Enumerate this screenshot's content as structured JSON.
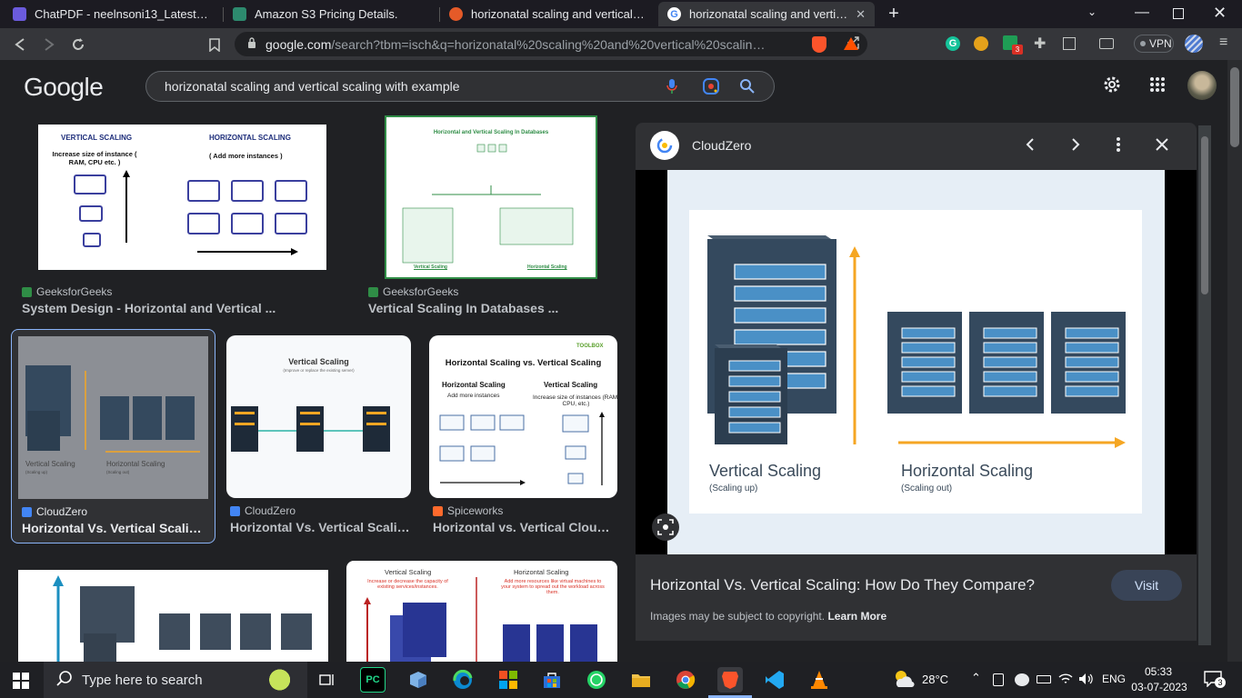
{
  "tabs": [
    {
      "title": "ChatPDF - neelnsoni13_Latest_Resume",
      "color": "#6b5bdc"
    },
    {
      "title": "Amazon S3 Pricing Details.",
      "color": "#2d8a6e"
    },
    {
      "title": "horizonatal scaling and vertical scaling",
      "color": "#e55a28"
    },
    {
      "title": "horizonatal scaling and vertical scaling",
      "color": "#4285f4"
    }
  ],
  "newtab": "+",
  "address": {
    "host": "google.com",
    "path": "/search?tbm=isch&q=horizonatal%20scaling%20and%20vertical%20scaling..."
  },
  "toolbar": {
    "vpn": "VPN",
    "ext_badge": "3"
  },
  "google": {
    "logo": "Google",
    "query": "horizonatal scaling and vertical scaling with example"
  },
  "results": [
    {
      "source": "GeeksforGeeks",
      "title": "System Design - Horizontal and Vertical ...",
      "src_color": "#2f8d46",
      "thumb": {
        "left_title": "VERTICAL SCALING",
        "left_sub": "Increase size of instance ( RAM, CPU etc. )",
        "right_title": "HORIZONTAL SCALING",
        "right_sub": "( Add more instances )"
      }
    },
    {
      "source": "GeeksforGeeks",
      "title": "Vertical Scaling In Databases ...",
      "src_color": "#2f8d46",
      "thumb": {
        "heading": "Horizontal and Vertical Scaling In Databases",
        "foot_left": "Vertical Scaling",
        "foot_right": "Horizontal Scaling"
      }
    },
    {
      "source": "CloudZero",
      "title": "Horizontal Vs. Vertical Scalin...",
      "src_color": "#4285f4",
      "thumb": {
        "left": "Vertical Scaling",
        "left_sub": "(Scaling up)",
        "right": "Horizontal Scaling",
        "right_sub": "(Scaling out)"
      }
    },
    {
      "source": "CloudZero",
      "title": "Horizontal Vs. Vertical Scalin...",
      "src_color": "#4285f4",
      "thumb": {
        "heading": "Vertical Scaling",
        "sub": "(Improve or replace the existing server)"
      }
    },
    {
      "source": "Spiceworks",
      "title": "Horizontal vs. Vertical Cloud ...",
      "src_color": "#ff6a2c",
      "thumb": {
        "brand": "TOOLBOX",
        "heading": "Horizontal Scaling vs. Vertical Scaling",
        "left": "Horizontal Scaling",
        "left_sub": "Add more instances",
        "right": "Vertical Scaling",
        "right_sub": "Increase size of instances (RAM, CPU, etc.)"
      }
    },
    {
      "thumb": {}
    },
    {
      "thumb": {
        "left": "Vertical Scaling",
        "left_sub": "Increase or decrease the capacity of existing services/instances.",
        "right": "Horizontal Scaling",
        "right_sub": "Add more resources like virtual machines to your system to spread out the workload across them."
      }
    }
  ],
  "panel": {
    "source": "CloudZero",
    "image": {
      "left": "Vertical Scaling",
      "left_sub": "(Scaling up)",
      "right": "Horizontal Scaling",
      "right_sub": "(Scaling out)"
    },
    "title": "Horizontal Vs. Vertical Scaling: How Do They Compare?",
    "visit": "Visit",
    "copyright": "Images may be subject to copyright.",
    "learn_more": "Learn More"
  },
  "taskbar": {
    "search_placeholder": "Type here to search",
    "weather": "28°C",
    "lang": "ENG",
    "time": "05:33",
    "date": "03-07-2023",
    "notif_count": "3"
  },
  "colors": {
    "accent": "#8ab4f8",
    "orange": "#f5a623",
    "server": "#34495e"
  }
}
